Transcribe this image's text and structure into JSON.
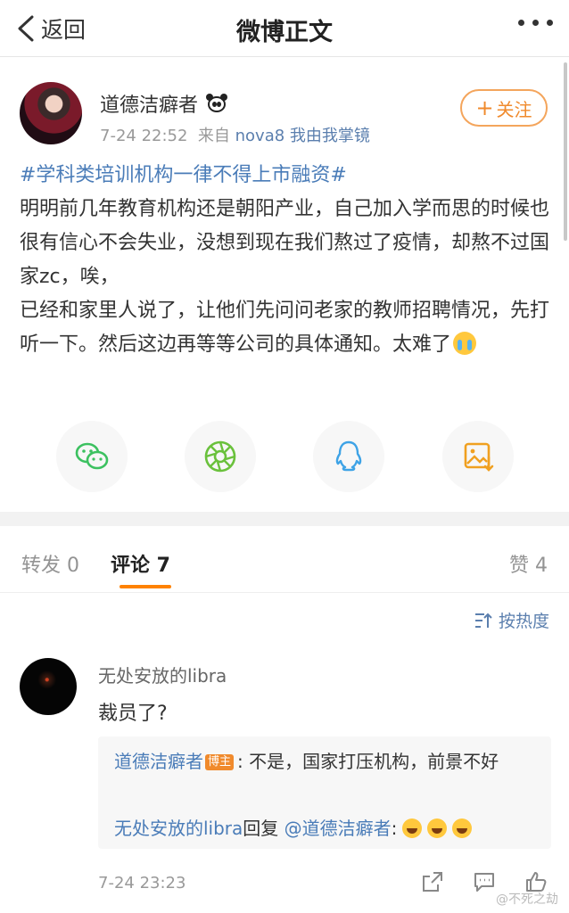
{
  "nav": {
    "back_label": "返回",
    "title": "微博正文"
  },
  "post": {
    "author": "道德洁癖者",
    "time": "7-24 22:52",
    "source_prefix": "来自",
    "source": "nova8 我由我掌镜",
    "follow_label": "关注",
    "topic": "#学科类培训机构一律不得上市融资#",
    "body_line1": "明明前几年教育机构还是朝阳产业，自己加入学而思的时候也很有信心不会失业，没想到现在我们熬过了疫情，却熬不过国家zc，唉，",
    "body_line2": "已经和家里人说了，让他们先问问老家的教师招聘情况，先打听一下。然后这边再等等公司的具体通知。太难了"
  },
  "share_icons": [
    "wechat-icon",
    "moments-icon",
    "qq-icon",
    "save-image-icon"
  ],
  "tabs": {
    "repost_label": "转发 0",
    "comment_label": "评论 7",
    "like_label": "赞 4"
  },
  "sort_label": "按热度",
  "comment": {
    "user": "无处安放的libra",
    "text": "裁员了?",
    "reply1_user": "道德洁癖者",
    "reply1_badge": "博主",
    "reply1_text": ": 不是，国家打压机构，前景不好",
    "reply2_user": "无处安放的libra",
    "reply2_mid": "回复",
    "reply2_mention": "@道德洁癖者",
    "reply2_colon": ":",
    "time": "7-24 23:23"
  },
  "watermark": "@不死之劫",
  "colors": {
    "accent": "#ff8200",
    "link": "#4a7cb8",
    "follow": "#f08a2c"
  }
}
